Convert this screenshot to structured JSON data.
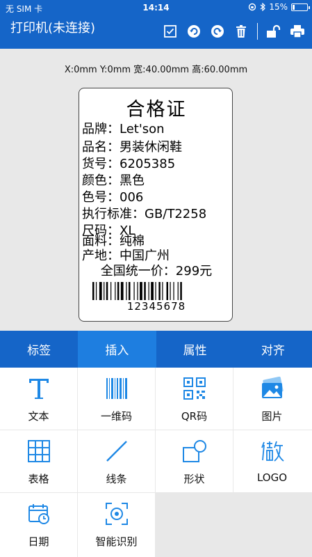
{
  "status": {
    "carrier": "无 SIM 卡",
    "time": "14:14",
    "battery": "15%",
    "battery_level": 0.15
  },
  "header": {
    "title": "打印机(未连接)"
  },
  "canvas": {
    "dimensions": "X:0mm  Y:0mm  宽:40.00mm  高:60.00mm"
  },
  "label": {
    "title": "合格证",
    "lines": [
      "品牌：Let'son",
      "品名：男装休闲鞋",
      "货号：6205385",
      "颜色：黑色",
      "色号：006",
      "执行标准：GB/T2258",
      "尺码：XL",
      "面料：纯棉",
      "产地：中国广州"
    ],
    "price": "全国统一价：299元",
    "barcode_number": "12345678"
  },
  "tabs": [
    {
      "label": "标签"
    },
    {
      "label": "插入",
      "active": true
    },
    {
      "label": "属性"
    },
    {
      "label": "对齐"
    }
  ],
  "insert_items": [
    {
      "label": "文本",
      "icon": "text-icon"
    },
    {
      "label": "一维码",
      "icon": "barcode-icon"
    },
    {
      "label": "QR码",
      "icon": "qrcode-icon"
    },
    {
      "label": "图片",
      "icon": "image-icon"
    },
    {
      "label": "表格",
      "icon": "table-icon"
    },
    {
      "label": "线条",
      "icon": "line-icon"
    },
    {
      "label": "形状",
      "icon": "shape-icon"
    },
    {
      "label": "LOGO",
      "icon": "logo-icon"
    },
    {
      "label": "日期",
      "icon": "calendar-icon"
    },
    {
      "label": "智能识别",
      "icon": "scan-icon"
    }
  ],
  "colors": {
    "primary": "#1565c8",
    "active_tab": "#1e7ee0",
    "icon": "#1e88e5"
  }
}
